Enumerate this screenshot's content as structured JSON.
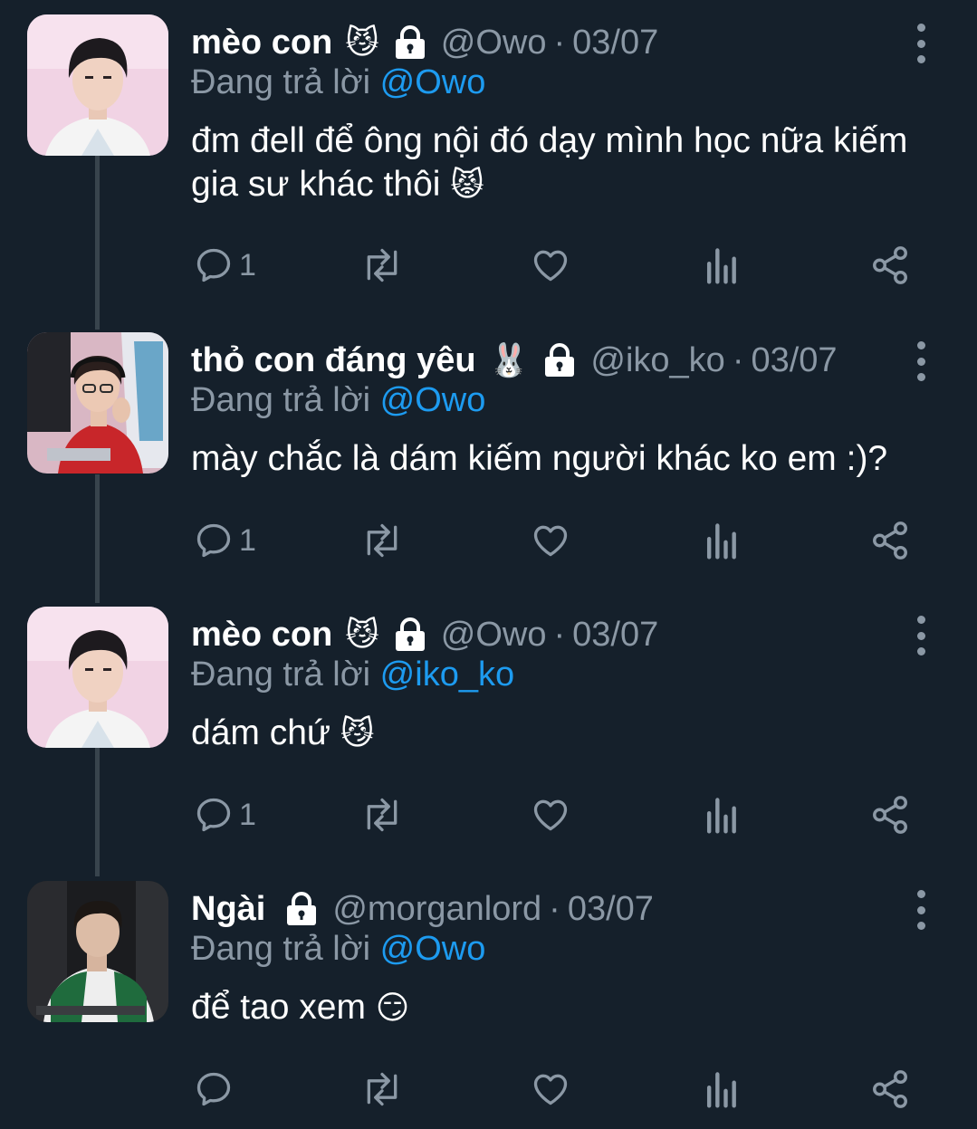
{
  "colors": {
    "background": "#15202b",
    "text": "#ffffff",
    "muted": "#8b98a5",
    "mention": "#1d9bf0",
    "thread_line": "#38444d"
  },
  "tweets": [
    {
      "name": "mèo con",
      "name_emoji": "😼",
      "handle": "@Owo",
      "separator": "·",
      "date": "03/07",
      "reply_prefix": "Đang trả lời",
      "reply_to": "@Owo",
      "text": "đm đell để ông nội đó dạy mình học nữa kiếm gia sư khác thôi",
      "text_emoji": "😾",
      "reply_count": "1",
      "avatar": "pink-portrait"
    },
    {
      "name": "thỏ con đáng yêu",
      "name_emoji": "🐰",
      "handle": "@iko_ko",
      "separator": "·",
      "date": "03/07",
      "reply_prefix": "Đang trả lời",
      "reply_to": "@Owo",
      "text": "mày chắc là dám kiếm người khác ko em :)?",
      "text_emoji": "",
      "reply_count": "1",
      "avatar": "red-jersey-gamer"
    },
    {
      "name": "mèo con",
      "name_emoji": "😼",
      "handle": "@Owo",
      "separator": "·",
      "date": "03/07",
      "reply_prefix": "Đang trả lời",
      "reply_to": "@iko_ko",
      "text": "dám chứ",
      "text_emoji": "😼",
      "reply_count": "1",
      "avatar": "pink-portrait"
    },
    {
      "name": "Ngài",
      "name_emoji": "",
      "handle": "@morganlord",
      "separator": "·",
      "date": "03/07",
      "reply_prefix": "Đang trả lời",
      "reply_to": "@Owo",
      "text": "để tao xem",
      "text_emoji": "😏",
      "reply_count": "",
      "avatar": "green-jersey-gamer"
    }
  ]
}
